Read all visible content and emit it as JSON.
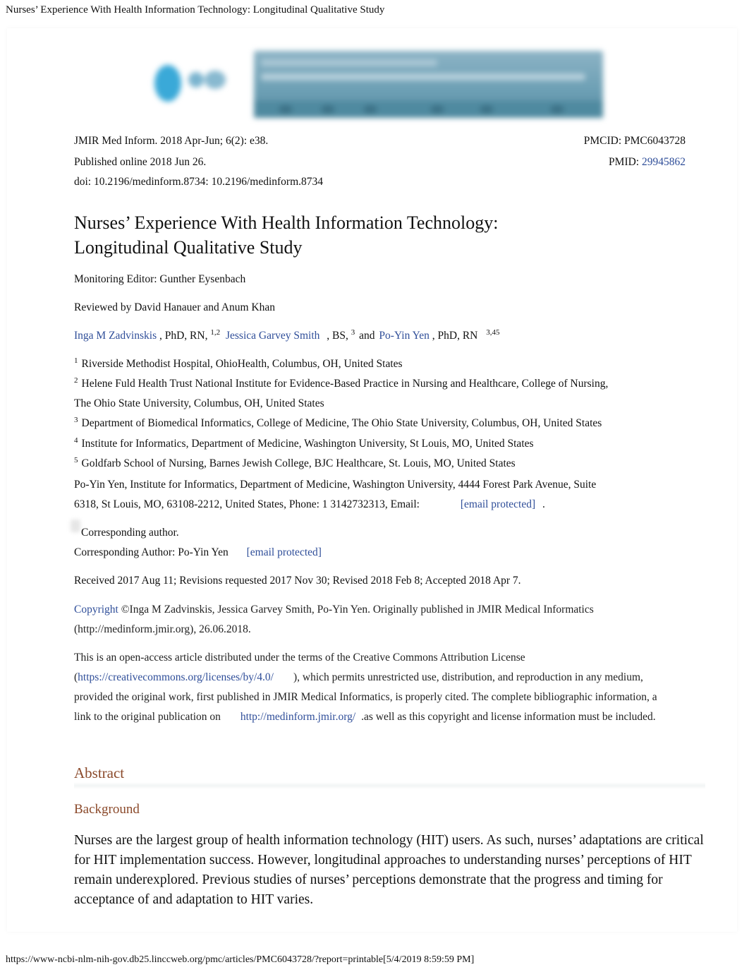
{
  "document_title": "Nurses’ Experience With Health Information Technology: Longitudinal Qualitative Study",
  "banner": {
    "description": "JMIR journal banner (blurred)"
  },
  "citation": {
    "journal": "JMIR Med Inform. 2018 Apr-Jun; 6(2): e38.",
    "published": "Published online 2018 Jun 26.",
    "doi": "doi: 10.2196/medinform.8734: 10.2196/medinform.8734",
    "pmcid": "PMCID: PMC6043728",
    "pmid_label": "PMID: ",
    "pmid": "29945862"
  },
  "article": {
    "title_line1": "Nurses’ Experience With Health Information Technology:",
    "title_line2": "Longitudinal Qualitative Study",
    "monitoring_editor": "Monitoring Editor: Gunther Eysenbach",
    "reviewers": "Reviewed by David Hanauer and Anum Khan"
  },
  "authors": [
    {
      "name": "Inga M Zadvinskis",
      "credentials": ", PhD, RN, ",
      "affil": "1,2"
    },
    {
      "name": "Jessica Garvey Smith",
      "credentials": ", BS, ",
      "affil": "3"
    },
    {
      "name": "Po-Yin Yen",
      "credentials": ", PhD, RN ",
      "affil": "3,45"
    }
  ],
  "authors_conjunction": "and",
  "affiliations": [
    {
      "num": "1",
      "text": "Riverside Methodist Hospital, OhioHealth, Columbus, OH, United States"
    },
    {
      "num": "2",
      "text": "Helene Fuld Health Trust National Institute for Evidence-Based Practice in Nursing and Healthcare, College of Nursing,",
      "text_cont": "The Ohio State University, Columbus, OH, United States"
    },
    {
      "num": "3",
      "text": "Department of Biomedical Informatics, College of Medicine, The Ohio State University, Columbus, OH, United States"
    },
    {
      "num": "4",
      "text": "Institute for Informatics, Department of Medicine, Washington University, St Louis, MO, United States"
    },
    {
      "num": "5",
      "text": "Goldfarb School of Nursing, Barnes Jewish College, BJC Healthcare, St. Louis, MO, United States"
    }
  ],
  "contact": {
    "line1": "Po-Yin Yen, Institute for Informatics, Department of Medicine, Washington University, 4444 Forest Park Avenue, Suite",
    "line2": "6318, St Louis, MO, 63108-2212, United States, Phone: 1 3142732313, Email:",
    "email_link": "[email protected]",
    "trailing": ".",
    "corresponding_note": "Corresponding author.",
    "corresponding_label": "Corresponding Author: Po-Yin Yen",
    "corresponding_email": "[email protected]"
  },
  "history": "Received 2017 Aug 11; Revisions requested 2017 Nov 30; Revised 2018 Feb 8; Accepted 2018 Apr 7.",
  "copyright": {
    "link": "Copyright",
    "text": " ©Inga M Zadvinskis, Jessica Garvey Smith, Po-Yin Yen. Originally published in JMIR Medical Informatics (http://medinform.jmir.org), 26.06.2018."
  },
  "license": {
    "part1": "This is an open-access article distributed under the terms of the Creative Commons Attribution License (",
    "cc_link": "https://creativecommons.org/licenses/by/4.0/",
    "part2": "), which permits unrestricted use, distribution, and reproduction in any medium, provided the original work, first published in JMIR Medical Informatics, is properly cited. The complete bibliographic information, a link to the original publication on ",
    "jmir_link": "http://medinform.jmir.org/",
    "part3": ".as well as this copyright and license information must be included."
  },
  "abstract": {
    "heading": "Abstract",
    "background_heading": "Background",
    "background_text": "Nurses are the largest group of health information technology (HIT) users. As such, nurses’ adaptations are critical for HIT implementation success. However, longitudinal approaches to understanding nurses’ perceptions of HIT remain underexplored. Previous studies of nurses’ perceptions demonstrate that the progress and timing for acceptance of and adaptation to HIT varies."
  },
  "footer": {
    "url": "https://www-ncbi-nlm-nih-gov.db25.linccweb.org/pmc/articles/PMC6043728/?report=printable[5/4/2019 8:59:59 PM]"
  }
}
